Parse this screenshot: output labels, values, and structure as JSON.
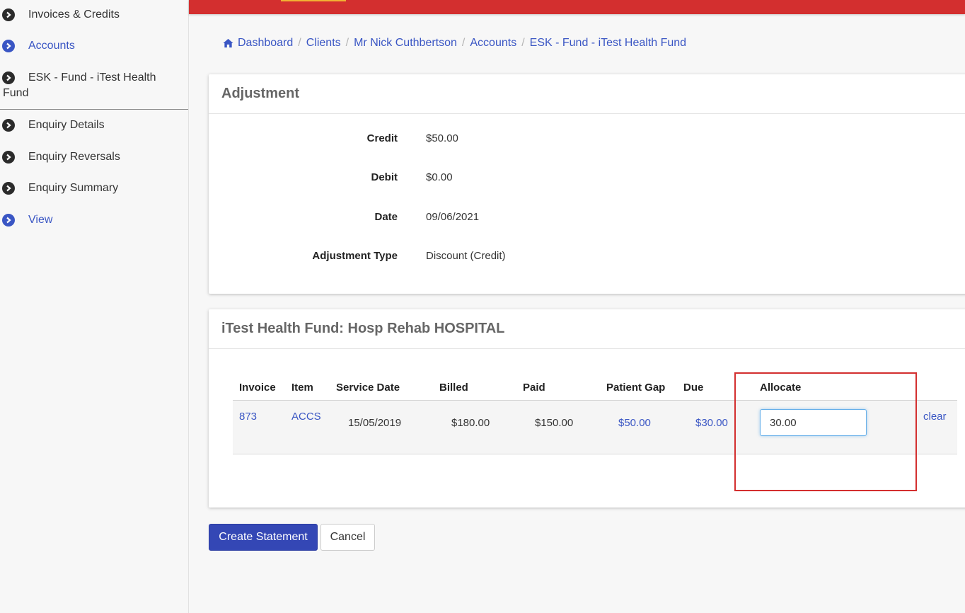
{
  "sidebar": {
    "items": [
      {
        "label": "Invoices & Credits",
        "icon": "chevron-right-circle-icon",
        "active": false
      },
      {
        "label": "Accounts",
        "icon": "chevron-right-circle-icon",
        "active": true
      },
      {
        "label": "ESK - Fund - iTest Health Fund",
        "icon": "chevron-right-circle-icon",
        "active": false
      },
      {
        "label": "Enquiry Details",
        "icon": "chevron-right-circle-icon",
        "active": false
      },
      {
        "label": "Enquiry Reversals",
        "icon": "chevron-right-circle-icon",
        "active": false
      },
      {
        "label": "Enquiry Summary",
        "icon": "chevron-right-circle-icon",
        "active": false
      },
      {
        "label": "View",
        "icon": "chevron-right-circle-icon",
        "active": true
      }
    ]
  },
  "breadcrumb": {
    "items": [
      "Dashboard",
      "Clients",
      "Mr Nick Cuthbertson",
      "Accounts",
      "ESK - Fund - iTest Health Fund"
    ],
    "separator": "/"
  },
  "adjustment": {
    "title": "Adjustment",
    "fields": [
      {
        "label": "Credit",
        "value": "$50.00"
      },
      {
        "label": "Debit",
        "value": "$0.00"
      },
      {
        "label": "Date",
        "value": "09/06/2021"
      },
      {
        "label": "Adjustment Type",
        "value": "Discount (Credit)"
      }
    ]
  },
  "allocation": {
    "title": "iTest Health Fund: Hosp Rehab HOSPITAL",
    "columns": [
      "Invoice",
      "Item",
      "Service Date",
      "Billed",
      "Paid",
      "Patient Gap",
      "Due",
      "Allocate"
    ],
    "row": {
      "invoice": "873",
      "item": "ACCS",
      "service_date": "15/05/2019",
      "billed": "$180.00",
      "paid": "$150.00",
      "patient_gap": "$50.00",
      "due": "$30.00",
      "allocate": "30.00",
      "clear_label": "clear"
    }
  },
  "actions": {
    "create_label": "Create Statement",
    "cancel_label": "Cancel"
  },
  "colors": {
    "brand_red": "#d32f2f",
    "link_blue": "#3a56c4",
    "primary_button": "#3447b5",
    "highlight": "#d32f2f"
  }
}
